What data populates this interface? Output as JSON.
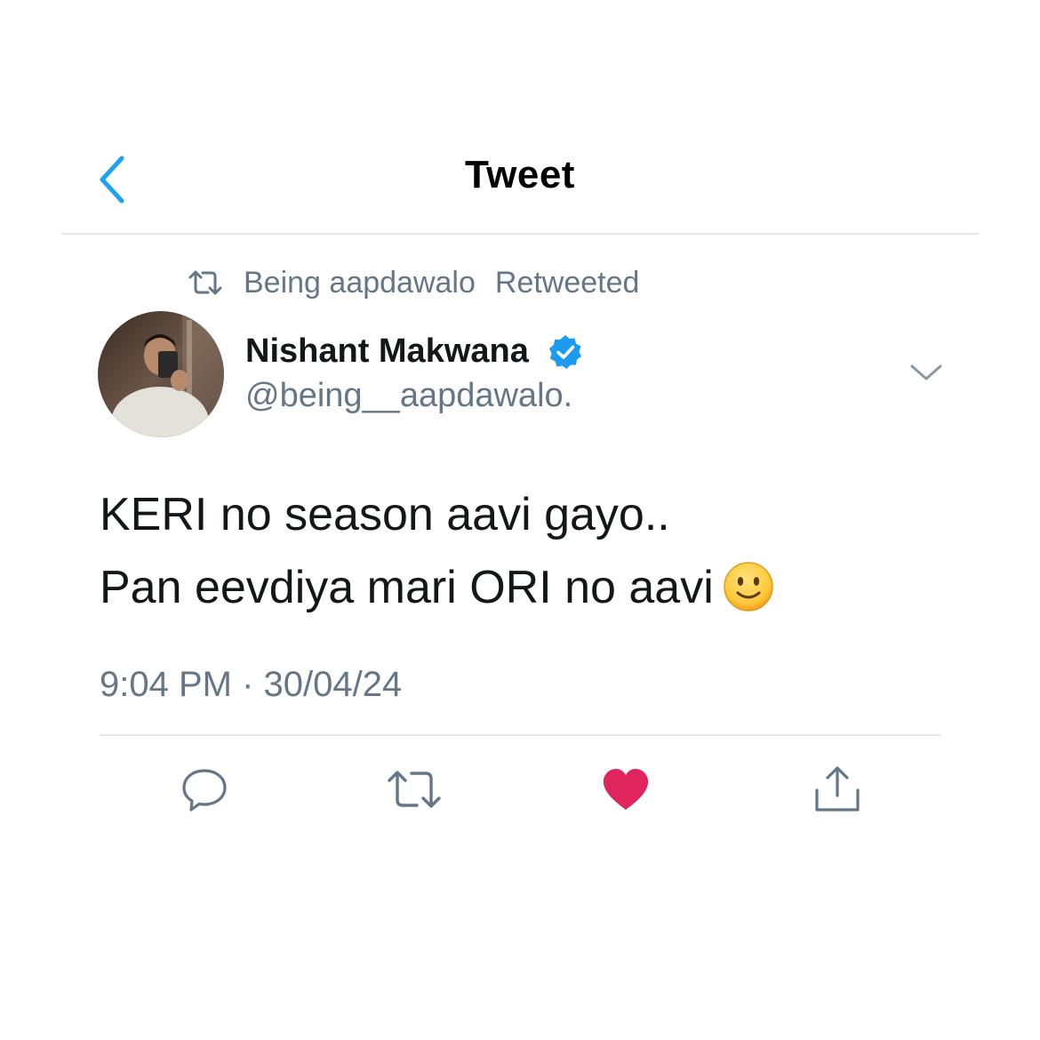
{
  "header": {
    "title": "Tweet",
    "back_icon": "chevron-left-icon",
    "accent_color": "#1da1f2"
  },
  "retweet_context": {
    "icon": "retweet-icon",
    "user": "Being aapdawalo",
    "label": "Retweeted"
  },
  "author": {
    "name": "Nishant Makwana",
    "handle": "@being__aapdawalo.",
    "verified": true,
    "verified_icon": "verified-badge-icon",
    "avatar": "avatar-photo",
    "menu_icon": "chevron-down-icon"
  },
  "tweet": {
    "lines": [
      "KERI no season aavi gayo..",
      "Pan eevdiya mari ORI no aavi"
    ],
    "emoji": "slightly-smiling-face-emoji",
    "time": "9:04 PM",
    "separator": "·",
    "date": "30/04/24"
  },
  "actions": {
    "reply_icon": "reply-icon",
    "retweet_icon": "retweet-icon",
    "like_icon": "heart-icon",
    "like_active": true,
    "like_color": "#e0245e",
    "share_icon": "share-icon"
  },
  "colors": {
    "text_primary": "#14171a",
    "text_secondary": "#657786",
    "divider": "#e1e8ed",
    "verified_blue": "#1d9bf0"
  }
}
